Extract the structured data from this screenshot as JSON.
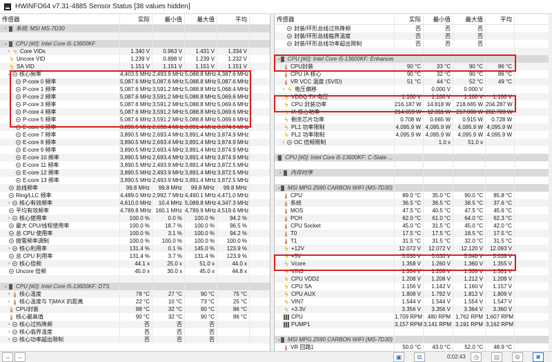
{
  "window": {
    "title": "HWiNFO64 v7.31-4885 Sensor Status [38 values hidden]"
  },
  "columns": {
    "sensor": "传感器",
    "current": "实际",
    "min": "最小值",
    "max": "最大值",
    "avg": "平均"
  },
  "left": {
    "rows": [
      {
        "type": "group",
        "exp": ">",
        "name": "系统: MSI MS-7D30"
      },
      {
        "type": "blank"
      },
      {
        "type": "group",
        "exp": "v",
        "name": "CPU [#0]: Intel Core i5-13600KF"
      },
      {
        "ind": 1,
        "exp": ">",
        "icon": "volt",
        "name": "Core VIDs",
        "v": [
          "1.340 V",
          "0.963 V",
          "1.431 V",
          "1.334 V"
        ]
      },
      {
        "ind": 0,
        "icon": "volt",
        "name": "Uncore VID",
        "v": [
          "1.239 V",
          "0.898 V",
          "1.239 V",
          "1.232 V"
        ]
      },
      {
        "ind": 0,
        "icon": "volt",
        "name": "SA VID",
        "v": [
          "1.151 V",
          "1.151 V",
          "1.151 V",
          "1.151 V"
        ]
      },
      {
        "ind": 1,
        "exp": "v",
        "icon": "clock",
        "name": "核心频率",
        "v": [
          "4,403.5 MHz",
          "2,493.9 MHz",
          "5,088.8 MHz",
          "4,387.6 MHz"
        ]
      },
      {
        "ind": 2,
        "icon": "clock",
        "name": "P-core 0 频率",
        "v": [
          "5,087.6 MHz",
          "5,087.6 MHz",
          "5,088.8 MHz",
          "5,087.6 MHz"
        ]
      },
      {
        "ind": 2,
        "icon": "clock",
        "name": "P-core 1 频率",
        "v": [
          "5,087.6 MHz",
          "3,591.2 MHz",
          "5,088.8 MHz",
          "5,068.4 MHz"
        ]
      },
      {
        "ind": 2,
        "icon": "clock",
        "name": "P-core 2 频率",
        "v": [
          "5,087.6 MHz",
          "3,591.2 MHz",
          "5,088.8 MHz",
          "5,069.6 MHz"
        ]
      },
      {
        "ind": 2,
        "icon": "clock",
        "name": "P-core 3 频率",
        "v": [
          "5,087.6 MHz",
          "3,591.2 MHz",
          "5,088.8 MHz",
          "5,069.6 MHz"
        ]
      },
      {
        "ind": 2,
        "icon": "clock",
        "name": "P-core 4 频率",
        "v": [
          "5,087.6 MHz",
          "3,591.2 MHz",
          "5,088.8 MHz",
          "5,069.6 MHz"
        ]
      },
      {
        "ind": 2,
        "icon": "clock",
        "name": "P-core 5 频率",
        "v": [
          "5,087.6 MHz",
          "3,591.2 MHz",
          "5,088.8 MHz",
          "5,069.6 MHz"
        ]
      },
      {
        "ind": 2,
        "icon": "clock",
        "name": "E-core 6 频率",
        "v": [
          "3,890.5 MHz",
          "2,693.4 MHz",
          "3,891.4 MHz",
          "3,874.9 MHz"
        ]
      },
      {
        "ind": 2,
        "icon": "clock",
        "name": "E-core 7 频率",
        "v": [
          "3,890.5 MHz",
          "2,693.4 MHz",
          "3,891.4 MHz",
          "3,874.9 MHz"
        ]
      },
      {
        "ind": 2,
        "icon": "clock",
        "name": "E-core 8 频率",
        "v": [
          "3,890.5 MHz",
          "2,693.4 MHz",
          "3,891.4 MHz",
          "3,874.9 MHz"
        ]
      },
      {
        "ind": 2,
        "icon": "clock",
        "name": "E-core 9 频率",
        "v": [
          "3,890.5 MHz",
          "2,693.4 MHz",
          "3,891.4 MHz",
          "3,874.9 MHz"
        ]
      },
      {
        "ind": 2,
        "icon": "clock",
        "name": "E-core 10 频率",
        "v": [
          "3,890.5 MHz",
          "2,693.4 MHz",
          "3,891.4 MHz",
          "3,874.9 MHz"
        ]
      },
      {
        "ind": 2,
        "icon": "clock",
        "name": "E-core 11 频率",
        "v": [
          "3,890.5 MHz",
          "2,493.9 MHz",
          "3,891.4 MHz",
          "3,872.5 MHz"
        ]
      },
      {
        "ind": 2,
        "icon": "clock",
        "name": "E-core 12 频率",
        "v": [
          "3,890.5 MHz",
          "2,493.9 MHz",
          "3,891.4 MHz",
          "3,872.5 MHz"
        ]
      },
      {
        "ind": 2,
        "icon": "clock",
        "name": "E-core 13 频率",
        "v": [
          "3,890.5 MHz",
          "2,493.9 MHz",
          "3,891.4 MHz",
          "3,872.5 MHz"
        ]
      },
      {
        "ind": 0,
        "icon": "clock",
        "name": "总线频率",
        "v": [
          "99.8 MHz",
          "99.8 MHz",
          "99.8 MHz",
          "99.8 MHz"
        ]
      },
      {
        "ind": 0,
        "icon": "clock",
        "name": "Ring/LLC 频率",
        "v": [
          "4,489.0 MHz",
          "2,992.7 MHz",
          "4,490.1 MHz",
          "4,471.0 MHz"
        ]
      },
      {
        "ind": 1,
        "exp": ">",
        "icon": "clock",
        "name": "核心有效频率",
        "v": [
          "4,610.0 MHz",
          "10.4 MHz",
          "5,089.8 MHz",
          "4,347.3 MHz"
        ]
      },
      {
        "ind": 0,
        "icon": "clock",
        "name": "平均有效频率",
        "v": [
          "4,789.8 MHz",
          "160.1 MHz",
          "4,789.9 MHz",
          "4,519.6 MHz"
        ]
      },
      {
        "ind": 1,
        "exp": ">",
        "icon": "clock",
        "name": "核心使用率",
        "v": [
          "100.0 %",
          "0.0 %",
          "100.0 %",
          "94.2 %"
        ]
      },
      {
        "ind": 0,
        "icon": "clock",
        "name": "最大 CPU/线程使用率",
        "v": [
          "100.0 %",
          "18.7 %",
          "100.0 %",
          "96.5 %"
        ]
      },
      {
        "ind": 0,
        "icon": "clock",
        "name": "总 CPU 使用率",
        "v": [
          "100.0 %",
          "3.1 %",
          "100.0 %",
          "94.2 %"
        ]
      },
      {
        "ind": 0,
        "icon": "clock",
        "name": "按需频率调制",
        "v": [
          "100.0 %",
          "100.0 %",
          "100.0 %",
          "100.0 %"
        ]
      },
      {
        "ind": 1,
        "exp": ">",
        "icon": "clock",
        "name": "核心利用率",
        "v": [
          "131.4 %",
          "0.1 %",
          "145.0 %",
          "123.9 %"
        ]
      },
      {
        "ind": 0,
        "icon": "clock",
        "name": "总 CPU 利用率",
        "v": [
          "131.4 %",
          "3.7 %",
          "131.4 %",
          "123.9 %"
        ]
      },
      {
        "ind": 1,
        "exp": ">",
        "icon": "clock",
        "name": "核心倍频",
        "v": [
          "44.1 x",
          "25.0 x",
          "51.0 x",
          "44.0 x"
        ]
      },
      {
        "ind": 0,
        "icon": "clock",
        "name": "Uncore 倍频",
        "v": [
          "45.0 x",
          "30.0 x",
          "45.0 x",
          "44.8 x"
        ]
      },
      {
        "type": "blank"
      },
      {
        "type": "group",
        "exp": "v",
        "name": "CPU [#0]: Intel Core i5-13600KF: DTS"
      },
      {
        "ind": 1,
        "exp": ">",
        "icon": "temp",
        "name": "核心温度",
        "v": [
          "78 °C",
          "27 °C",
          "90 °C",
          "75 °C"
        ]
      },
      {
        "ind": 1,
        "exp": ">",
        "icon": "temp",
        "name": "核心温度与 TjMAX 的距离",
        "v": [
          "22 °C",
          "10 °C",
          "73 °C",
          "25 °C"
        ]
      },
      {
        "ind": 0,
        "icon": "temp",
        "name": "CPU封装",
        "v": [
          "88 °C",
          "32 °C",
          "90 °C",
          "86 °C"
        ]
      },
      {
        "ind": 0,
        "icon": "temp",
        "name": "核心最高值",
        "v": [
          "90 °C",
          "32 °C",
          "90 °C",
          "86 °C"
        ]
      },
      {
        "ind": 1,
        "exp": ">",
        "icon": "clock",
        "name": "核心过热降频",
        "v": [
          "否",
          "否",
          "否",
          ""
        ]
      },
      {
        "ind": 1,
        "exp": ">",
        "icon": "clock",
        "name": "核心临界温度",
        "v": [
          "否",
          "否",
          "否",
          ""
        ]
      },
      {
        "ind": 1,
        "exp": ">",
        "icon": "clock",
        "name": "核心功率超出限制",
        "v": [
          "否",
          "否",
          "否",
          ""
        ]
      }
    ]
  },
  "right": {
    "rows": [
      {
        "ind": 1,
        "icon": "clock",
        "name": "封装/环形总线过热降频",
        "v": [
          "否",
          "否",
          "否",
          ""
        ]
      },
      {
        "ind": 1,
        "icon": "clock",
        "name": "封装/环形总线临界温度",
        "v": [
          "否",
          "否",
          "否",
          ""
        ]
      },
      {
        "ind": 1,
        "icon": "clock",
        "name": "封装/环形总线功率超出限制",
        "v": [
          "否",
          "否",
          "否",
          ""
        ]
      },
      {
        "type": "blank"
      },
      {
        "type": "group",
        "exp": "v",
        "name": "CPU [#0]: Intel Core i5-13600KF: Enhanced"
      },
      {
        "ind": 0,
        "icon": "temp",
        "name": "CPU封装",
        "v": [
          "90 °C",
          "33 °C",
          "90 °C",
          "86 °C"
        ]
      },
      {
        "ind": 0,
        "icon": "temp",
        "name": "CPU IA 核心",
        "v": [
          "90 °C",
          "32 °C",
          "90 °C",
          "86 °C"
        ]
      },
      {
        "ind": 0,
        "icon": "temp",
        "name": "VR VCC 温度 (SVID)",
        "v": [
          "51 °C",
          "44 °C",
          "52 °C",
          "49 °C"
        ]
      },
      {
        "ind": 1,
        "exp": ">",
        "icon": "volt",
        "name": "电压偏移",
        "v": [
          "",
          "0.000 V",
          "0.000 V",
          ""
        ]
      },
      {
        "ind": 0,
        "icon": "volt",
        "name": "VDDQ TX 电压",
        "v": [
          "1.100 V",
          "1.100 V",
          "1.100 V",
          "1.100 V"
        ]
      },
      {
        "ind": 0,
        "icon": "volt",
        "name": "CPU 封装功率",
        "v": [
          "216.187 W",
          "14.818 W",
          "218.665 W",
          "204.287 W"
        ]
      },
      {
        "ind": 0,
        "icon": "volt",
        "name": "IA 核心功率",
        "v": [
          "214.659 W",
          "12.311 W",
          "217.000 W",
          "202.723 W"
        ]
      },
      {
        "ind": 0,
        "icon": "volt",
        "name": "剩余芯片功率",
        "v": [
          "0.708 W",
          "0.665 W",
          "0.915 W",
          "0.728 W"
        ]
      },
      {
        "ind": 0,
        "icon": "volt",
        "name": "PL1 功率限制",
        "v": [
          "4,095.9 W",
          "4,095.9 W",
          "4,095.9 W",
          "4,095.9 W"
        ]
      },
      {
        "ind": 0,
        "icon": "volt",
        "name": "PL2 功率限制",
        "v": [
          "4,095.9 W",
          "4,095.9 W",
          "4,095.9 W",
          "4,095.9 W"
        ]
      },
      {
        "ind": 1,
        "exp": ">",
        "icon": "clock",
        "name": "OC 倍频限制",
        "v": [
          "",
          "1.0 x",
          "51.0 x",
          ""
        ]
      },
      {
        "type": "blank"
      },
      {
        "type": "group",
        "exp": ">",
        "name": "CPU [#0]: Intel Core i5-13600KF: C-State ..."
      },
      {
        "type": "blank"
      },
      {
        "type": "group",
        "exp": ">",
        "name": "内存时序"
      },
      {
        "type": "blank"
      },
      {
        "type": "group",
        "exp": "v",
        "name": "MSI MPG Z690 CARBON WIFI (MS-7D30) (..."
      },
      {
        "ind": 0,
        "icon": "temp",
        "name": "CPU",
        "v": [
          "89.0 °C",
          "35.0 °C",
          "90.0 °C",
          "85.8 °C"
        ]
      },
      {
        "ind": 0,
        "icon": "temp",
        "name": "系统",
        "v": [
          "36.5 °C",
          "36.5 °C",
          "38.5 °C",
          "37.6 °C"
        ]
      },
      {
        "ind": 0,
        "icon": "temp",
        "name": "MOS",
        "v": [
          "47.5 °C",
          "40.5 °C",
          "47.5 °C",
          "45.6 °C"
        ]
      },
      {
        "ind": 0,
        "icon": "temp",
        "name": "PCH",
        "v": [
          "62.0 °C",
          "61.0 °C",
          "64.0 °C",
          "62.3 °C"
        ]
      },
      {
        "ind": 0,
        "icon": "temp",
        "name": "CPU Socket",
        "v": [
          "45.0 °C",
          "31.5 °C",
          "45.0 °C",
          "42.0 °C"
        ]
      },
      {
        "ind": 0,
        "icon": "temp",
        "name": "T0",
        "v": [
          "17.5 °C",
          "17.5 °C",
          "18.5 °C",
          "17.5 °C"
        ]
      },
      {
        "ind": 0,
        "icon": "temp",
        "name": "T1",
        "v": [
          "31.5 °C",
          "31.5 °C",
          "32.0 °C",
          "31.5 °C"
        ]
      },
      {
        "ind": 0,
        "icon": "volt",
        "name": "+12V",
        "v": [
          "12.072 V",
          "12.072 V",
          "12.120 V",
          "12.093 V"
        ]
      },
      {
        "ind": 0,
        "icon": "volt",
        "name": "+5V",
        "v": [
          "5.030 V",
          "5.030 V",
          "5.040 V",
          "5.039 V"
        ]
      },
      {
        "ind": 0,
        "icon": "volt",
        "name": "Vcore",
        "v": [
          "1.358 V",
          "1.260 V",
          "1.360 V",
          "1.355 V"
        ]
      },
      {
        "ind": 0,
        "icon": "volt",
        "name": "VIN3",
        "v": [
          "1.304 V",
          "1.208 V",
          "1.308 V",
          "1.301 V"
        ]
      },
      {
        "ind": 0,
        "icon": "volt",
        "name": "CPU VDD2",
        "v": [
          "1.208 V",
          "1.208 V",
          "1.212 V",
          "1.209 V"
        ]
      },
      {
        "ind": 0,
        "icon": "volt",
        "name": "CPU SA",
        "v": [
          "1.156 V",
          "1.142 V",
          "1.160 V",
          "1.157 V"
        ]
      },
      {
        "ind": 0,
        "icon": "volt",
        "name": "CPU AUX",
        "v": [
          "1.808 V",
          "1.792 V",
          "1.812 V",
          "1.809 V"
        ]
      },
      {
        "ind": 0,
        "icon": "volt",
        "name": "VIN7",
        "v": [
          "1.544 V",
          "1.544 V",
          "1.554 V",
          "1.547 V"
        ]
      },
      {
        "ind": 0,
        "icon": "volt",
        "name": "+3.3V",
        "v": [
          "3.356 V",
          "3.356 V",
          "3.364 V",
          "3.360 V"
        ]
      },
      {
        "ind": 0,
        "icon": "fan",
        "name": "CPU",
        "v": [
          "1,709 RPM",
          "480 RPM",
          "1,762 RPM",
          "1,607 RPM"
        ]
      },
      {
        "ind": 0,
        "icon": "fan",
        "name": "PUMP1",
        "v": [
          "3,157 RPM",
          "3,141 RPM",
          "3,191 RPM",
          "3,162 RPM"
        ]
      },
      {
        "type": "blank"
      },
      {
        "type": "group",
        "exp": "v",
        "name": "MSI MPG Z690 CARBON WIFI (MS-7D30) (..."
      },
      {
        "ind": 0,
        "icon": "temp",
        "name": "VR 回路1",
        "v": [
          "50.0 °C",
          "43.0 °C",
          "52.0 °C",
          "48.9 °C"
        ]
      }
    ]
  },
  "toolbar": {
    "elapsed": "0:02:43"
  },
  "colors": {
    "highlight": "#d81c1c",
    "group_bg": "#d9d9d9"
  }
}
